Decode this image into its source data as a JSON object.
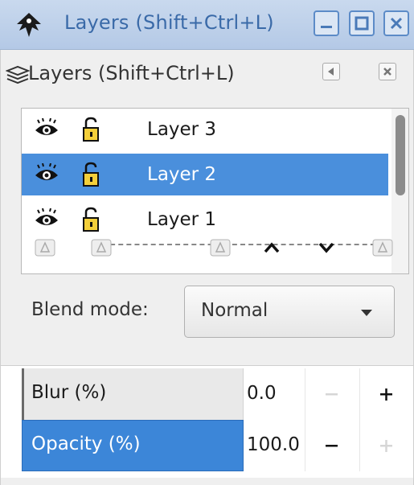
{
  "window": {
    "title": "Layers (Shift+Ctrl+L)",
    "buttons": [
      "minimize",
      "maximize",
      "close"
    ]
  },
  "dock": {
    "title": "Layers (Shift+Ctrl+L)"
  },
  "layers": [
    {
      "name": "Layer 3",
      "visible": true,
      "locked": false,
      "selected": false
    },
    {
      "name": "Layer 2",
      "visible": true,
      "locked": false,
      "selected": true
    },
    {
      "name": "Layer 1",
      "visible": true,
      "locked": false,
      "selected": false
    }
  ],
  "blend": {
    "label": "Blend mode:",
    "value": "Normal"
  },
  "sliders": {
    "blur": {
      "label": "Blur (%)",
      "value": "0.0",
      "level": 0
    },
    "opacity": {
      "label": "Opacity (%)",
      "value": "100.0",
      "level": 100
    }
  },
  "colors": {
    "selection": "#4a8fdc",
    "titlebar": "#c9d9ee",
    "title_text": "#3a6aa8"
  }
}
